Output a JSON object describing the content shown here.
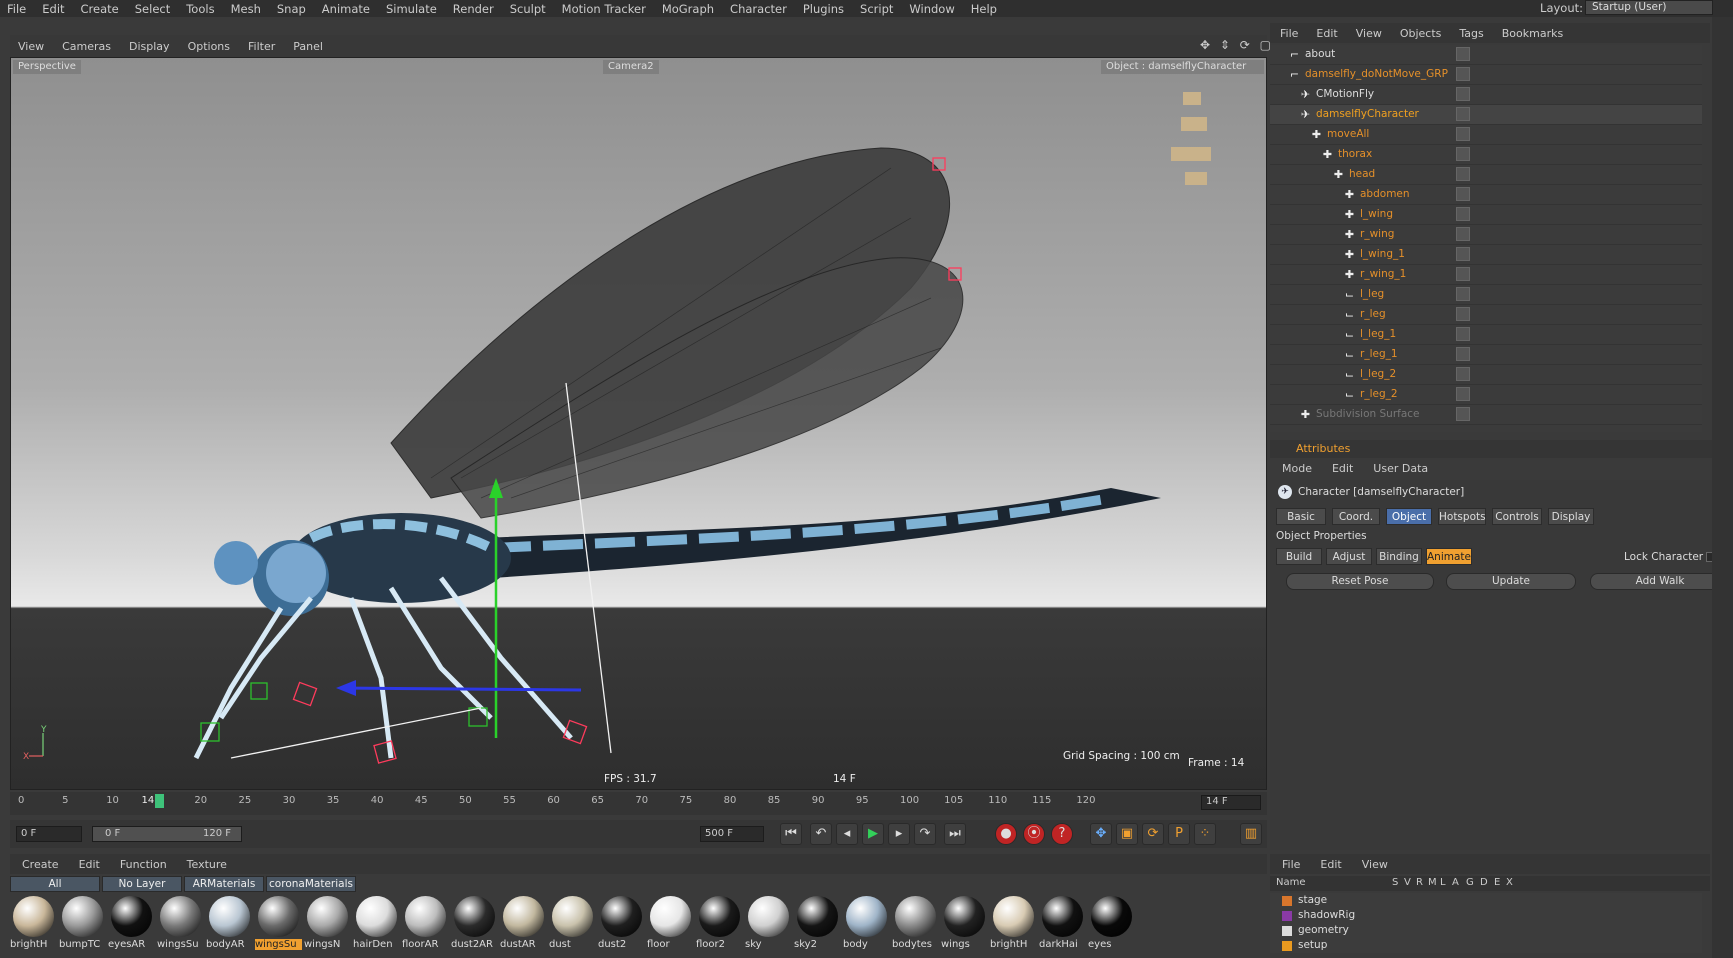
{
  "menubar": {
    "items": [
      "File",
      "Edit",
      "Create",
      "Select",
      "Tools",
      "Mesh",
      "Snap",
      "Animate",
      "Simulate",
      "Render",
      "Sculpt",
      "Motion Tracker",
      "MoGraph",
      "Character",
      "Plugins",
      "Script",
      "Window",
      "Help"
    ],
    "layout_label": "Layout:",
    "layout_value": "Startup (User)"
  },
  "viewport": {
    "menu": [
      "View",
      "Cameras",
      "Display",
      "Options",
      "Filter",
      "Panel"
    ],
    "perspective": "Perspective",
    "camera": "Camera2",
    "object_label": "Object : damselflyCharacter",
    "grid_spacing": "Grid Spacing : 100 cm",
    "frame": "Frame : 14",
    "fps": "FPS : 31.7",
    "frame_center": "14 F"
  },
  "timeline": {
    "ticks": [
      "0",
      "5",
      "10",
      "14",
      "20",
      "25",
      "30",
      "35",
      "40",
      "45",
      "50",
      "55",
      "60",
      "65",
      "70",
      "75",
      "80",
      "85",
      "90",
      "95",
      "100",
      "105",
      "110",
      "115",
      "120"
    ],
    "current": "14 F"
  },
  "transport": {
    "start": "0 F",
    "range_start": "0 F",
    "range_end": "120 F",
    "end": "500 F"
  },
  "materials": {
    "menu": [
      "Create",
      "Edit",
      "Function",
      "Texture"
    ],
    "tabs": [
      "All",
      "No Layer",
      "ARMaterials",
      "coronaMaterials"
    ],
    "items": [
      {
        "name": "brightH",
        "color": "#c9b79a"
      },
      {
        "name": "bumpTC",
        "color": "#9a9a9a"
      },
      {
        "name": "eyesAR",
        "color": "#111"
      },
      {
        "name": "wingsSu",
        "color": "#7a7a7a"
      },
      {
        "name": "bodyAR",
        "color": "#b9c6d2"
      },
      {
        "name": "wingsSu",
        "color": "#6a6a6a"
      },
      {
        "name": "wingsN",
        "color": "#a9a9a9"
      },
      {
        "name": "hairDen",
        "color": "#dcdcdc"
      },
      {
        "name": "floorAR",
        "color": "#bdbdbd"
      },
      {
        "name": "dust2AR",
        "color": "#2b2b2b"
      },
      {
        "name": "dustAR",
        "color": "#c2b89f"
      },
      {
        "name": "dust",
        "color": "#c9c2ac"
      },
      {
        "name": "dust2",
        "color": "#1f1f1f"
      },
      {
        "name": "floor",
        "color": "#e6e6e6"
      },
      {
        "name": "floor2",
        "color": "#1a1a1a"
      },
      {
        "name": "sky",
        "color": "#d0d0d0"
      },
      {
        "name": "sky2",
        "color": "#151515"
      },
      {
        "name": "body",
        "color": "#9fb4c8"
      },
      {
        "name": "bodytes",
        "color": "#8a8a8a"
      },
      {
        "name": "wings",
        "color": "#222"
      },
      {
        "name": "brightH",
        "color": "#d8cbb3"
      },
      {
        "name": "darkHai",
        "color": "#111"
      },
      {
        "name": "eyes",
        "color": "#090909"
      }
    ]
  },
  "objects": {
    "menu": [
      "File",
      "Edit",
      "View",
      "Objects",
      "Tags",
      "Bookmarks"
    ],
    "items": [
      {
        "name": "about",
        "color": "#dddddd",
        "indent": 0
      },
      {
        "name": "damselfly_doNotMove_GRP",
        "color": "#e5902a",
        "indent": 0
      },
      {
        "name": "CMotionFly",
        "color": "#dddddd",
        "indent": 1
      },
      {
        "name": "damselflyCharacter",
        "color": "#f0a020",
        "indent": 1
      },
      {
        "name": "moveAll",
        "color": "#e5902a",
        "indent": 2
      },
      {
        "name": "thorax",
        "color": "#e5902a",
        "indent": 3
      },
      {
        "name": "head",
        "color": "#e5902a",
        "indent": 4
      },
      {
        "name": "abdomen",
        "color": "#e5902a",
        "indent": 5
      },
      {
        "name": "l_wing",
        "color": "#e5902a",
        "indent": 5
      },
      {
        "name": "r_wing",
        "color": "#e5902a",
        "indent": 5
      },
      {
        "name": "l_wing_1",
        "color": "#e5902a",
        "indent": 5
      },
      {
        "name": "r_wing_1",
        "color": "#e5902a",
        "indent": 5
      },
      {
        "name": "l_leg",
        "color": "#e5902a",
        "indent": 5
      },
      {
        "name": "r_leg",
        "color": "#e5902a",
        "indent": 5
      },
      {
        "name": "l_leg_1",
        "color": "#e5902a",
        "indent": 5
      },
      {
        "name": "r_leg_1",
        "color": "#e5902a",
        "indent": 5
      },
      {
        "name": "l_leg_2",
        "color": "#e5902a",
        "indent": 5
      },
      {
        "name": "r_leg_2",
        "color": "#e5902a",
        "indent": 5
      },
      {
        "name": "Subdivision Surface",
        "color": "#777777",
        "indent": 1
      }
    ]
  },
  "attributes": {
    "title": "Attributes",
    "menu": [
      "Mode",
      "Edit",
      "User Data"
    ],
    "object": "Character [damselflyCharacter]",
    "tabs": [
      "Basic",
      "Coord.",
      "Object",
      "Hotspots",
      "Controls",
      "Display"
    ],
    "section": "Object Properties",
    "subtabs": [
      "Build",
      "Adjust",
      "Binding",
      "Animate"
    ],
    "lock_label": "Lock Character",
    "buttons": [
      "Reset Pose",
      "Update",
      "Add Walk"
    ]
  },
  "layers": {
    "menu": [
      "File",
      "Edit",
      "View"
    ],
    "columns": [
      "Name",
      "S",
      "V",
      "R",
      "M",
      "L",
      "A",
      "G",
      "D",
      "E",
      "X"
    ],
    "items": [
      {
        "name": "stage",
        "color": "#d8762c"
      },
      {
        "name": "shadowRig",
        "color": "#8a3aa6"
      },
      {
        "name": "geometry",
        "color": "#ddd"
      },
      {
        "name": "setup",
        "color": "#e99a20"
      }
    ]
  }
}
